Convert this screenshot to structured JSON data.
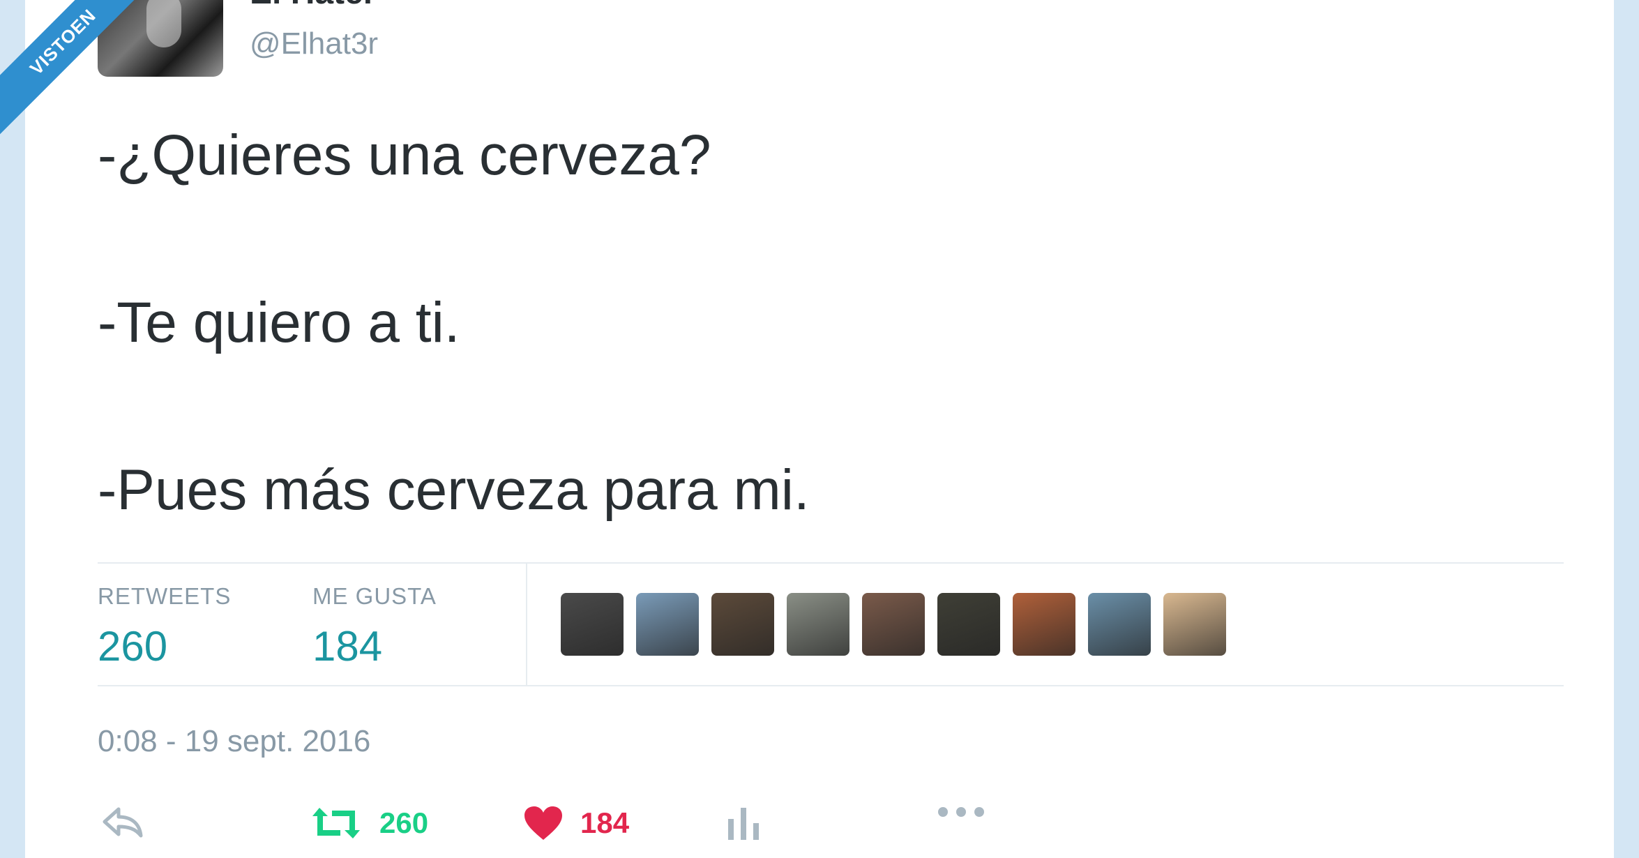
{
  "ribbon": {
    "text": "VISTOEN"
  },
  "author": {
    "name": "El Hater",
    "handle": "@Elhat3r"
  },
  "tweet": {
    "lines": [
      "-¿Quieres una cerveza?",
      "-Te quiero a ti.",
      "-Pues más cerveza para mi."
    ]
  },
  "stats": {
    "retweets_label": "RETWEETS",
    "retweets_value": "260",
    "likes_label": "ME GUSTA",
    "likes_value": "184"
  },
  "likers": [
    {
      "color": "#4a4a4a"
    },
    {
      "color": "#7a9bb8"
    },
    {
      "color": "#5c4a3a"
    },
    {
      "color": "#8a8f86"
    },
    {
      "color": "#7a5a4a"
    },
    {
      "color": "#3f3f36"
    },
    {
      "color": "#b0603a"
    },
    {
      "color": "#6a8fa8"
    },
    {
      "color": "#d9b890"
    }
  ],
  "timestamp": "0:08 - 19 sept. 2016",
  "actions": {
    "retweet_count": "260",
    "like_count": "184"
  },
  "colors": {
    "accent_retweet": "#19cf86",
    "accent_like": "#e2264d",
    "stat_value": "#1b95a0",
    "muted": "#8899a6",
    "ribbon": "#2f8fcf"
  },
  "icons": [
    "reply-icon",
    "retweet-icon",
    "heart-icon",
    "analytics-icon",
    "more-icon"
  ]
}
